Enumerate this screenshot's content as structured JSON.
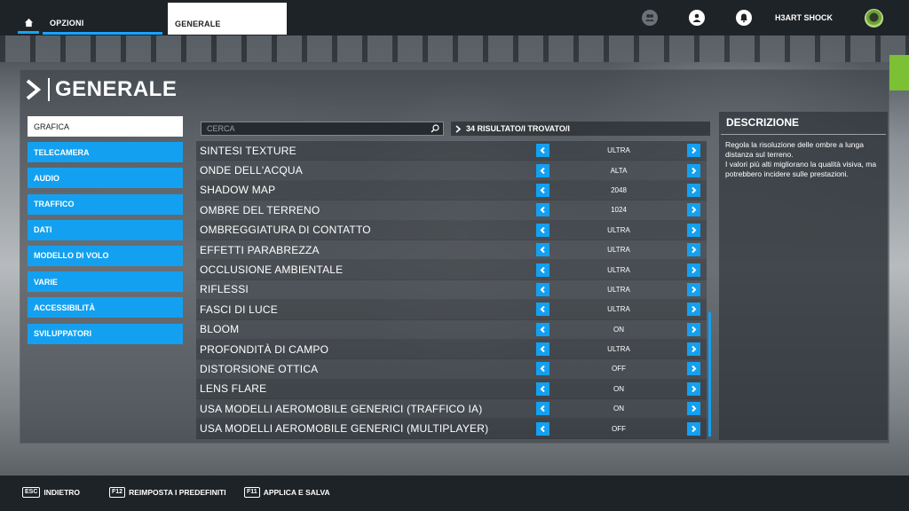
{
  "topbar": {
    "tab_options": "OPZIONI",
    "tab_general": "GENERALE",
    "username": "H3ART SHOCK"
  },
  "page": {
    "title": "GENERALE"
  },
  "categories": [
    {
      "label": "GRAFICA",
      "active": true
    },
    {
      "label": "TELECAMERA"
    },
    {
      "label": "AUDIO"
    },
    {
      "label": "TRAFFICO"
    },
    {
      "label": "DATI"
    },
    {
      "label": "MODELLO DI VOLO"
    },
    {
      "label": "VARIE"
    },
    {
      "label": "ACCESSIBILITÀ"
    },
    {
      "label": "SVILUPPATORI"
    }
  ],
  "search": {
    "placeholder": "CERCA"
  },
  "results": {
    "label": "34 RISULTATO/I TROVATO/I"
  },
  "settings": [
    {
      "label": "SINTESI TEXTURE",
      "value": "ULTRA"
    },
    {
      "label": "ONDE DELL'ACQUA",
      "value": "ALTA"
    },
    {
      "label": "SHADOW MAP",
      "value": "2048"
    },
    {
      "label": "OMBRE DEL TERRENO",
      "value": "1024"
    },
    {
      "label": "OMBREGGIATURA DI CONTATTO",
      "value": "ULTRA"
    },
    {
      "label": "EFFETTI PARABREZZA",
      "value": "ULTRA"
    },
    {
      "label": "OCCLUSIONE AMBIENTALE",
      "value": "ULTRA"
    },
    {
      "label": "RIFLESSI",
      "value": "ULTRA"
    },
    {
      "label": "FASCI DI LUCE",
      "value": "ULTRA"
    },
    {
      "label": "BLOOM",
      "value": "ON"
    },
    {
      "label": "PROFONDITÀ DI CAMPO",
      "value": "ULTRA"
    },
    {
      "label": "DISTORSIONE OTTICA",
      "value": "OFF"
    },
    {
      "label": "LENS FLARE",
      "value": "ON"
    },
    {
      "label": "USA MODELLI AEROMOBILE GENERICI (TRAFFICO IA)",
      "value": "ON"
    },
    {
      "label": "USA MODELLI AEROMOBILE GENERICI (MULTIPLAYER)",
      "value": "OFF"
    }
  ],
  "description": {
    "title": "DESCRIZIONE",
    "text": "Regola la risoluzione delle ombre a lunga distanza sul terreno.\nI valori più alti migliorano la qualità visiva, ma potrebbero incidere sulle prestazioni."
  },
  "footer": {
    "back_key": "ESC",
    "back_label": "INDIETRO",
    "reset_key": "F12",
    "reset_label": "REIMPOSTA I PREDEFINITI",
    "apply_key": "F11",
    "apply_label": "APPLICA E SALVA"
  },
  "colors": {
    "accent": "#14a0f0",
    "bar": "#1e2327"
  }
}
